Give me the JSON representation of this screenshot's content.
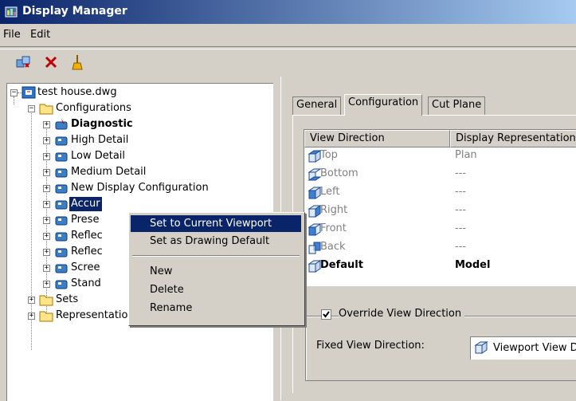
{
  "window": {
    "title": "Display Manager"
  },
  "menu": {
    "file": "File",
    "edit": "Edit"
  },
  "toolbar": {
    "buttons": [
      "new-config-icon",
      "delete-icon",
      "purge-icon"
    ]
  },
  "tree": {
    "root": "test house.dwg",
    "configurations": "Configurations",
    "items": [
      "Diagnostic",
      "High Detail",
      "Low Detail",
      "Medium Detail",
      "New Display Configuration",
      "Accur",
      "Prese",
      "Reflec",
      "Reflec",
      "Scree",
      "Stand"
    ],
    "sets": "Sets",
    "representations": "Representations by Object"
  },
  "context_menu": {
    "items": [
      "Set to Current Viewport",
      "Set as Drawing Default",
      "New",
      "Delete",
      "Rename"
    ]
  },
  "tabs": [
    "General",
    "Configuration",
    "Cut Plane"
  ],
  "table": {
    "headers": [
      "View Direction",
      "Display Representation"
    ],
    "rows": [
      {
        "direction": "Top",
        "rep": "Plan"
      },
      {
        "direction": "Bottom",
        "rep": "---"
      },
      {
        "direction": "Left",
        "rep": "---"
      },
      {
        "direction": "Right",
        "rep": "---"
      },
      {
        "direction": "Front",
        "rep": "---"
      },
      {
        "direction": "Back",
        "rep": "---"
      },
      {
        "direction": "Default",
        "rep": "Model"
      }
    ]
  },
  "override": {
    "checked": true,
    "label": "Override View Direction"
  },
  "fixed": {
    "label": "Fixed View Direction:",
    "value": "Viewport View D"
  },
  "colors": {
    "title_start": "#0a246a",
    "title_end": "#a6caf0",
    "selection": "#0a246a",
    "face": "#d4d0c8"
  }
}
